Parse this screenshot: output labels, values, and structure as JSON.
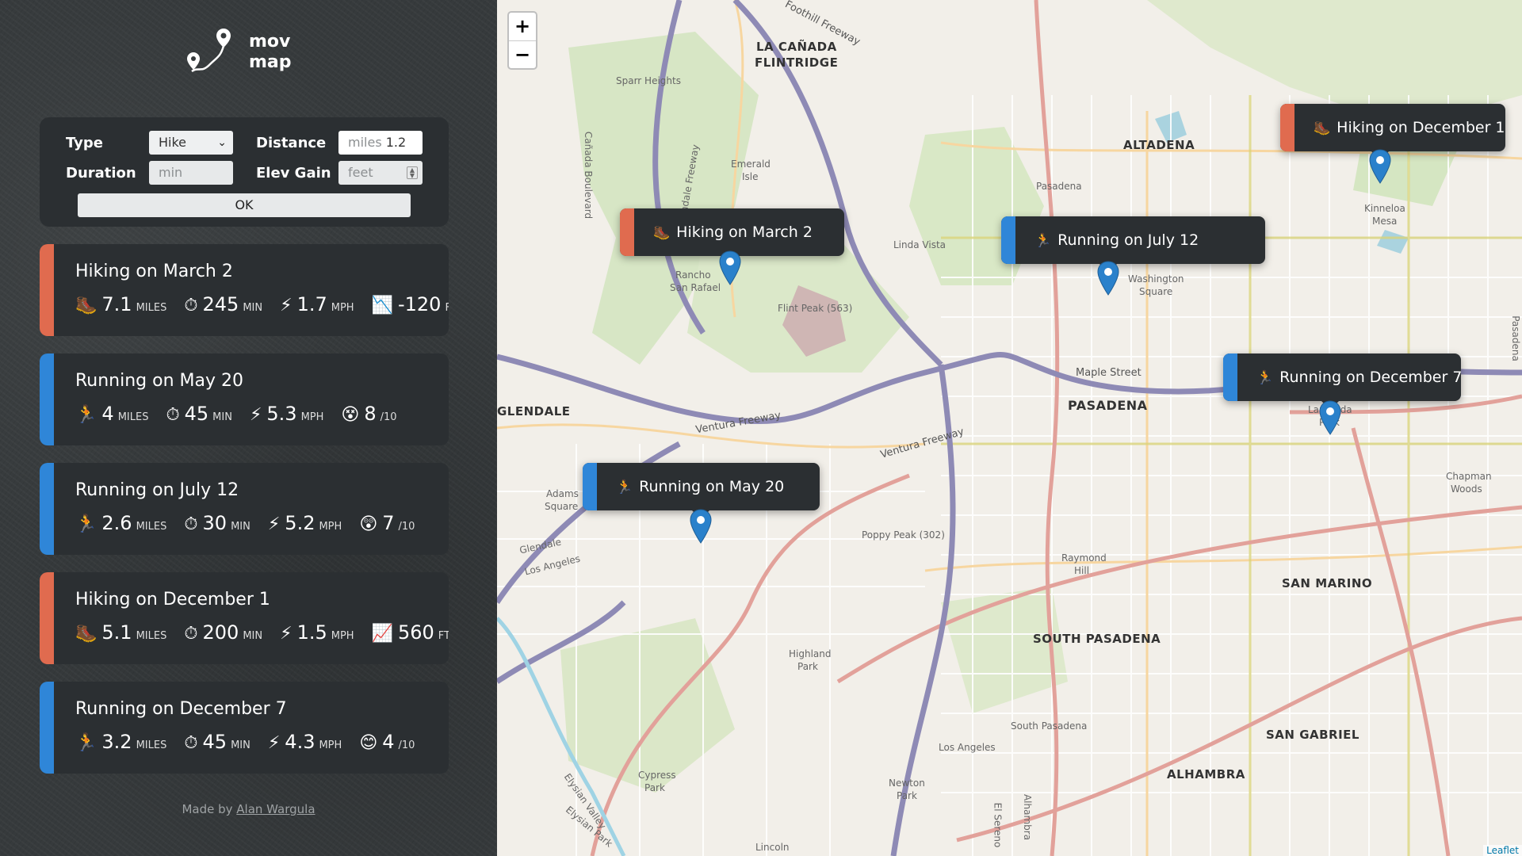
{
  "app": {
    "logo_line1": "mov",
    "logo_line2": "map"
  },
  "form": {
    "type_label": "Type",
    "type_value": "Hike",
    "distance_label": "Distance",
    "distance_placeholder": "miles",
    "distance_value": "1.2",
    "duration_label": "Duration",
    "duration_placeholder": "min",
    "elev_label": "Elev Gain",
    "elev_placeholder": "feet",
    "ok_label": "OK"
  },
  "colors": {
    "hike": "#e06b4f",
    "run": "#2f86d8",
    "marker": "#2a81cb"
  },
  "workouts": [
    {
      "title": "Hiking on March 2",
      "kind": "hike",
      "stats": [
        {
          "icon": "hiking-boot-icon",
          "glyph": "🥾",
          "value": "7.1",
          "unit": "MILES"
        },
        {
          "icon": "stopwatch-icon",
          "glyph": "⏱",
          "value": "245",
          "unit": "MIN"
        },
        {
          "icon": "lightning-icon",
          "glyph": "⚡",
          "value": "1.7",
          "unit": "MPH"
        },
        {
          "icon": "chart-decreasing-icon",
          "glyph": "📉",
          "value": "-120",
          "unit": "FT"
        }
      ]
    },
    {
      "title": "Running on May 20",
      "kind": "run",
      "stats": [
        {
          "icon": "runner-icon",
          "glyph": "🏃",
          "value": "4",
          "unit": "MILES"
        },
        {
          "icon": "stopwatch-icon",
          "glyph": "⏱",
          "value": "45",
          "unit": "MIN"
        },
        {
          "icon": "lightning-icon",
          "glyph": "⚡",
          "value": "5.3",
          "unit": "MPH"
        },
        {
          "icon": "astonished-face-icon",
          "glyph": "😵",
          "value": "8",
          "unit": "/10"
        }
      ]
    },
    {
      "title": "Running on July 12",
      "kind": "run",
      "stats": [
        {
          "icon": "runner-icon",
          "glyph": "🏃",
          "value": "2.6",
          "unit": "MILES"
        },
        {
          "icon": "stopwatch-icon",
          "glyph": "⏱",
          "value": "30",
          "unit": "MIN"
        },
        {
          "icon": "lightning-icon",
          "glyph": "⚡",
          "value": "5.2",
          "unit": "MPH"
        },
        {
          "icon": "astonished-face-icon",
          "glyph": "😲",
          "value": "7",
          "unit": "/10"
        }
      ]
    },
    {
      "title": "Hiking on December 1",
      "kind": "hike",
      "stats": [
        {
          "icon": "hiking-boot-icon",
          "glyph": "🥾",
          "value": "5.1",
          "unit": "MILES"
        },
        {
          "icon": "stopwatch-icon",
          "glyph": "⏱",
          "value": "200",
          "unit": "MIN"
        },
        {
          "icon": "lightning-icon",
          "glyph": "⚡",
          "value": "1.5",
          "unit": "MPH"
        },
        {
          "icon": "chart-increasing-icon",
          "glyph": "📈",
          "value": "560",
          "unit": "FT"
        }
      ]
    },
    {
      "title": "Running on December 7",
      "kind": "run",
      "stats": [
        {
          "icon": "runner-icon",
          "glyph": "🏃",
          "value": "3.2",
          "unit": "MILES"
        },
        {
          "icon": "stopwatch-icon",
          "glyph": "⏱",
          "value": "45",
          "unit": "MIN"
        },
        {
          "icon": "lightning-icon",
          "glyph": "⚡",
          "value": "4.3",
          "unit": "MPH"
        },
        {
          "icon": "smiling-face-icon",
          "glyph": "😊",
          "value": "4",
          "unit": "/10"
        }
      ]
    }
  ],
  "footer": {
    "prefix": "Made by",
    "author": "Alan Wargula"
  },
  "map": {
    "zoom_in": "+",
    "zoom_out": "−",
    "attribution": "Leaflet",
    "popups": [
      {
        "title": "Hiking on March 2",
        "kind": "hike",
        "glyph": "🥾"
      },
      {
        "title": "Running on May 20",
        "kind": "run",
        "glyph": "🏃"
      },
      {
        "title": "Running on July 12",
        "kind": "run",
        "glyph": "🏃"
      },
      {
        "title": "Hiking on December 1",
        "kind": "hike",
        "glyph": "🥾"
      },
      {
        "title": "Running on December 7",
        "kind": "run",
        "glyph": "🏃"
      }
    ],
    "place_labels": {
      "la_canada": "LA CAÑADA",
      "flintridge": "FLINTRIDGE",
      "altadena": "ALTADENA",
      "pasadena": "PASADENA",
      "glendale": "GLENDALE",
      "south_pasadena": "SOUTH PASADENA",
      "san_marino": "SAN MARINO",
      "san_gabriel": "SAN GABRIEL",
      "alhambra": "ALHAMBRA",
      "sparr_heights": "Sparr Heights",
      "emerald_isle_1": "Emerald",
      "emerald_isle_2": "Isle",
      "linda_vista": "Linda Vista",
      "flint_peak": "Flint Peak (563)",
      "rancho_1": "Rancho",
      "rancho_2": "San Rafael",
      "washington_1": "Washington",
      "washington_2": "Square",
      "kinneloa_1": "Kinneloa",
      "kinneloa_2": "Mesa",
      "maple_street": "Maple Street",
      "ventura_fwy_1": "Ventura Freeway",
      "ventura_fwy_2": "Ventura Freeway",
      "foothill_fwy": "Foothill Freeway",
      "lamanda_1": "Lamanda",
      "lamanda_2": "Park",
      "chapman_1": "Chapman",
      "chapman_2": "Woods",
      "adams_1": "Adams",
      "adams_2": "Square",
      "glendale_small": "Glendale",
      "los_angeles_1": "Los Angeles",
      "poppy_peak": "Poppy Peak (302)",
      "raymond_1": "Raymond",
      "raymond_2": "Hill",
      "highland_1": "Highland",
      "highland_2": "Park",
      "south_pasadena_small": "South Pasadena",
      "los_angeles_2": "Los Angeles",
      "cypress_1": "Cypress",
      "cypress_2": "Park",
      "newton_1": "Newton",
      "newton_2": "Park",
      "pasadena_side": "Pasadena",
      "pasadena_small": "Pasadena",
      "lincoln": "Lincoln",
      "el_sereno": "El Sereno",
      "alhambra_street": "Alhambra",
      "canada_blvd": "Cañada Boulevard",
      "elysian_1": "Elysian Valley",
      "elysian_2": "Elysian Park",
      "glendale_fwy": "Glendale Freeway"
    }
  }
}
